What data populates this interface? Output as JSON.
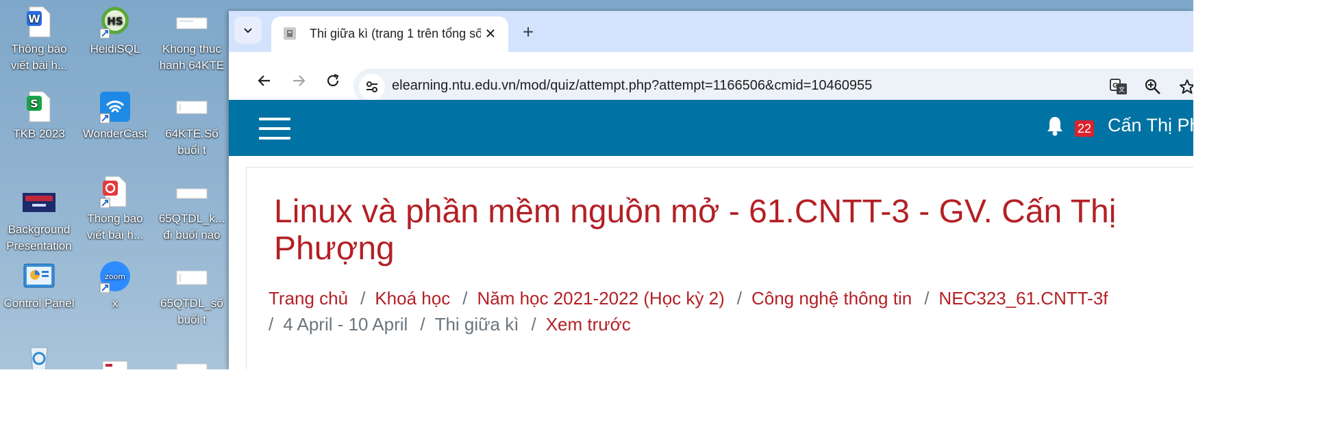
{
  "desktop": {
    "icons": [
      {
        "label": "Thông báo viết bài h...",
        "icon": "wps-writer-icon"
      },
      {
        "label": "HeidiSQL",
        "icon": "heidisql-icon"
      },
      {
        "label": "Khong thuc hanh 64KTE",
        "icon": "document-file-icon"
      },
      {
        "label": "TKB 2023",
        "icon": "wps-spreadsheet-icon"
      },
      {
        "label": "WonderCast",
        "icon": "wondercast-icon"
      },
      {
        "label": "64KTE.Số buổi t",
        "icon": "document-file-icon"
      },
      {
        "label": "Background Presentation",
        "icon": "presentation-file-icon"
      },
      {
        "label": "Thông báo viết bài h...",
        "icon": "wps-pdf-icon"
      },
      {
        "label": "65QTDL_k... đi buổi nào",
        "icon": "document-file-icon"
      },
      {
        "label": "Control Panel",
        "icon": "control-panel-icon"
      },
      {
        "label": "x",
        "icon": "zoom-icon"
      },
      {
        "label": "65QTDL_số buổi t",
        "icon": "document-file-icon"
      }
    ]
  },
  "browser": {
    "tab_title": "Thi giữa kì (trang 1 trên tổng số",
    "url": "elearning.ntu.edu.vn/mod/quiz/attempt.php?attempt=1166506&cmid=10460955"
  },
  "site": {
    "notification_count": "22",
    "user_name": "Cấn Thị Phượng",
    "course_title": "Linux và phần mềm nguồn mở - 61.CNTT-3 - GV. Cấn Thị Phượng",
    "breadcrumb": [
      {
        "label": "Trang chủ",
        "link": true
      },
      {
        "label": "Khoá học",
        "link": true
      },
      {
        "label": "Năm học 2021-2022 (Học kỳ 2)",
        "link": true
      },
      {
        "label": "Công nghệ thông tin",
        "link": true
      },
      {
        "label": "NEC323_61.CNTT-3f",
        "link": true
      },
      {
        "label": "4 April - 10 April",
        "link": false
      },
      {
        "label": "Thi giữa kì",
        "link": false
      },
      {
        "label": "Xem trước",
        "link": true
      }
    ]
  },
  "colors": {
    "header_blue": "#0072a3",
    "title_red": "#b32025",
    "badge_red": "#d9232d",
    "tabstrip": "#d3e3fd"
  }
}
